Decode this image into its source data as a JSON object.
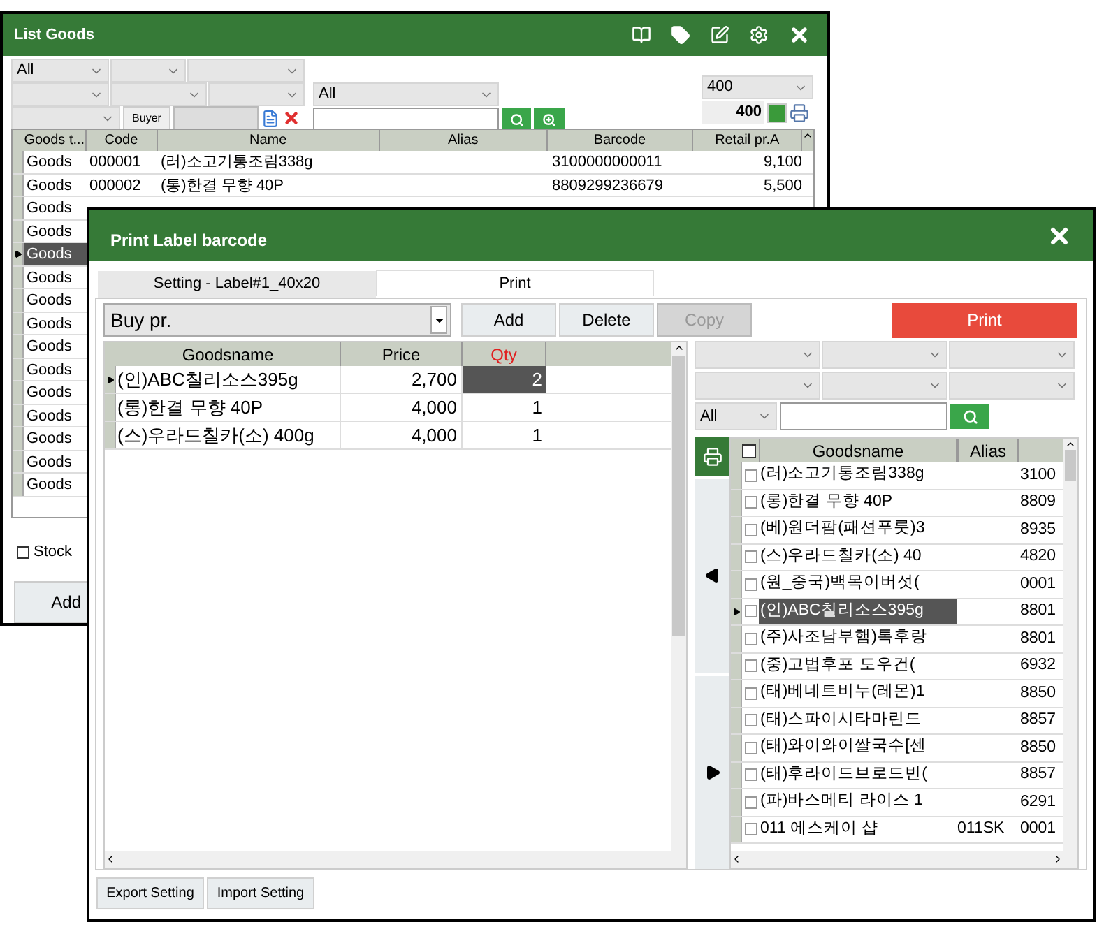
{
  "list_goods": {
    "title": "List Goods",
    "filter_1": "All",
    "filter_2": "All",
    "buyer_button": "Buyer",
    "page_size": "400",
    "count": "400",
    "columns": [
      "Goods t...",
      "Code",
      "Name",
      "Alias",
      "Barcode",
      "Retail pr.A"
    ],
    "rows": [
      {
        "goods_type": "Goods",
        "code": "000001",
        "name": "(러)소고기통조림338g",
        "barcode": "3100000000011",
        "price": "9,100",
        "selected": false
      },
      {
        "goods_type": "Goods",
        "code": "000002",
        "name": "(통)한결 무향 40P",
        "barcode": "8809299236679",
        "price": "5,500",
        "selected": false
      },
      {
        "goods_type": "Goods",
        "selected": false
      },
      {
        "goods_type": "Goods",
        "selected": false
      },
      {
        "goods_type": "Goods",
        "selected": true
      },
      {
        "goods_type": "Goods",
        "selected": false
      },
      {
        "goods_type": "Goods",
        "selected": false
      },
      {
        "goods_type": "Goods",
        "selected": false
      },
      {
        "goods_type": "Goods",
        "selected": false
      },
      {
        "goods_type": "Goods",
        "selected": false
      },
      {
        "goods_type": "Goods",
        "selected": false
      },
      {
        "goods_type": "Goods",
        "selected": false
      },
      {
        "goods_type": "Goods",
        "selected": false
      },
      {
        "goods_type": "Goods",
        "selected": false
      },
      {
        "goods_type": "Goods",
        "selected": false
      }
    ],
    "stock": {
      "label": "Stock",
      "checked": false
    },
    "add_button": "Add"
  },
  "dialog": {
    "title": "Print Label barcode",
    "tabs": [
      {
        "label": "Setting - Label#1_40x20",
        "selected": false
      },
      {
        "label": "Print",
        "selected": true
      }
    ],
    "price_type": "Buy pr.",
    "buttons": [
      {
        "label": "Add",
        "disabled": false
      },
      {
        "label": "Delete",
        "disabled": false
      },
      {
        "label": "Copy",
        "disabled": true
      }
    ],
    "print_button": "Print",
    "print_columns": [
      "Goodsname",
      "Price",
      "Qty"
    ],
    "print_rows": [
      {
        "name": "(인)ABC칠리소스395g",
        "price": "2,700",
        "qty": "2",
        "selected": true
      },
      {
        "name": "(롱)한결 무향 40P",
        "price": "4,000",
        "qty": "1",
        "selected": false
      },
      {
        "name": "(스)우라드칠카(소) 400g",
        "price": "4,000",
        "qty": "1",
        "selected": false
      }
    ],
    "goods_filter": "All",
    "select_all_checked": false,
    "goods_columns": [
      "Goodsname",
      "Alias"
    ],
    "goods_rows": [
      {
        "name": "(러)소고기통조림338g",
        "barcode": "3100",
        "checked": false,
        "selected": false
      },
      {
        "name": "(롱)한결 무향 40P",
        "barcode": "8809",
        "checked": false,
        "selected": false
      },
      {
        "name": "(베)원더팜(패션푸룻)3",
        "barcode": "8935",
        "checked": false,
        "selected": false
      },
      {
        "name": "(스)우라드칠카(소) 40",
        "barcode": "4820",
        "checked": false,
        "selected": false
      },
      {
        "name": "(원_중국)백목이버섯(",
        "barcode": "0001",
        "checked": false,
        "selected": false
      },
      {
        "name": "(인)ABC칠리소스395g",
        "barcode": "8801",
        "checked": false,
        "selected": true
      },
      {
        "name": "(주)사조남부햄)톡후랑",
        "barcode": "8801",
        "checked": false,
        "selected": false
      },
      {
        "name": "(중)고법후포 도우건(",
        "barcode": "6932",
        "checked": false,
        "selected": false
      },
      {
        "name": "(태)베네트비누(레몬)1",
        "barcode": "8850",
        "checked": false,
        "selected": false
      },
      {
        "name": "(태)스파이시타마린드",
        "barcode": "8857",
        "checked": false,
        "selected": false
      },
      {
        "name": "(태)와이와이쌀국수[센",
        "barcode": "8850",
        "checked": false,
        "selected": false
      },
      {
        "name": "(태)후라이드브로드빈(",
        "barcode": "8857",
        "checked": false,
        "selected": false
      },
      {
        "name": "(파)바스메티 라이스 1",
        "barcode": "6291",
        "checked": false,
        "selected": false
      },
      {
        "name": "011 에스케이 샵",
        "alias": "011SK",
        "barcode": "0001",
        "checked": false,
        "selected": false
      }
    ],
    "footer_buttons": [
      "Export Setting",
      "Import Setting"
    ]
  }
}
